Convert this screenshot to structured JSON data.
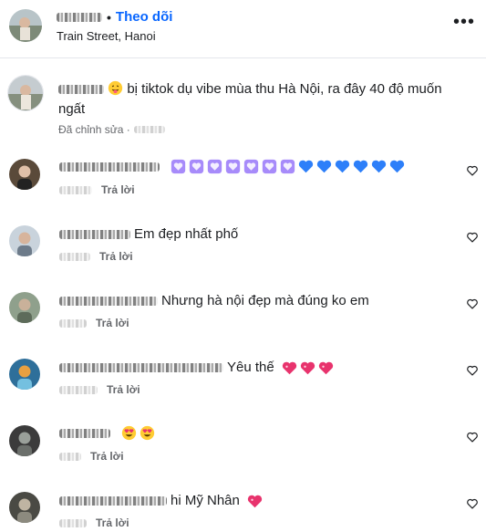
{
  "header": {
    "follow_label": "Theo dõi",
    "separator": "•",
    "location": "Train Street, Hanoi"
  },
  "caption": {
    "text_prefix": "bị tiktok dụ vibe mùa thu Hà Nội, ra đây 40 độ muốn ngất",
    "edited_label": "Đã chỉnh sửa ·"
  },
  "comments": [
    {
      "text": "",
      "emojis": [
        "purple-heart",
        "purple-heart",
        "purple-heart",
        "purple-heart",
        "purple-heart",
        "purple-heart",
        "purple-heart",
        "blue-heart",
        "blue-heart",
        "blue-heart",
        "blue-heart",
        "blue-heart",
        "blue-heart"
      ],
      "reply_label": "Trả lời"
    },
    {
      "text": "Em đẹp nhất phố",
      "emojis": [],
      "reply_label": "Trả lời"
    },
    {
      "text": "Nhưng hà nội đẹp mà đúng ko em",
      "emojis": [],
      "reply_label": "Trả lời"
    },
    {
      "text": "Yêu thế",
      "emojis": [
        "pink-heart",
        "pink-heart",
        "pink-heart"
      ],
      "reply_label": "Trả lời"
    },
    {
      "text": "",
      "emojis": [
        "heart-eyes",
        "heart-eyes"
      ],
      "reply_label": "Trả lời"
    },
    {
      "text": "hi Mỹ Nhân",
      "emojis": [
        "pink-heart"
      ],
      "reply_label": "Trả lời"
    }
  ],
  "colors": {
    "accent": "#0866ff",
    "secondary_text": "#65676b",
    "purple_heart": "#a78bfa",
    "blue_heart": "#2d7ff9",
    "pink_heart": "#e8336d"
  }
}
